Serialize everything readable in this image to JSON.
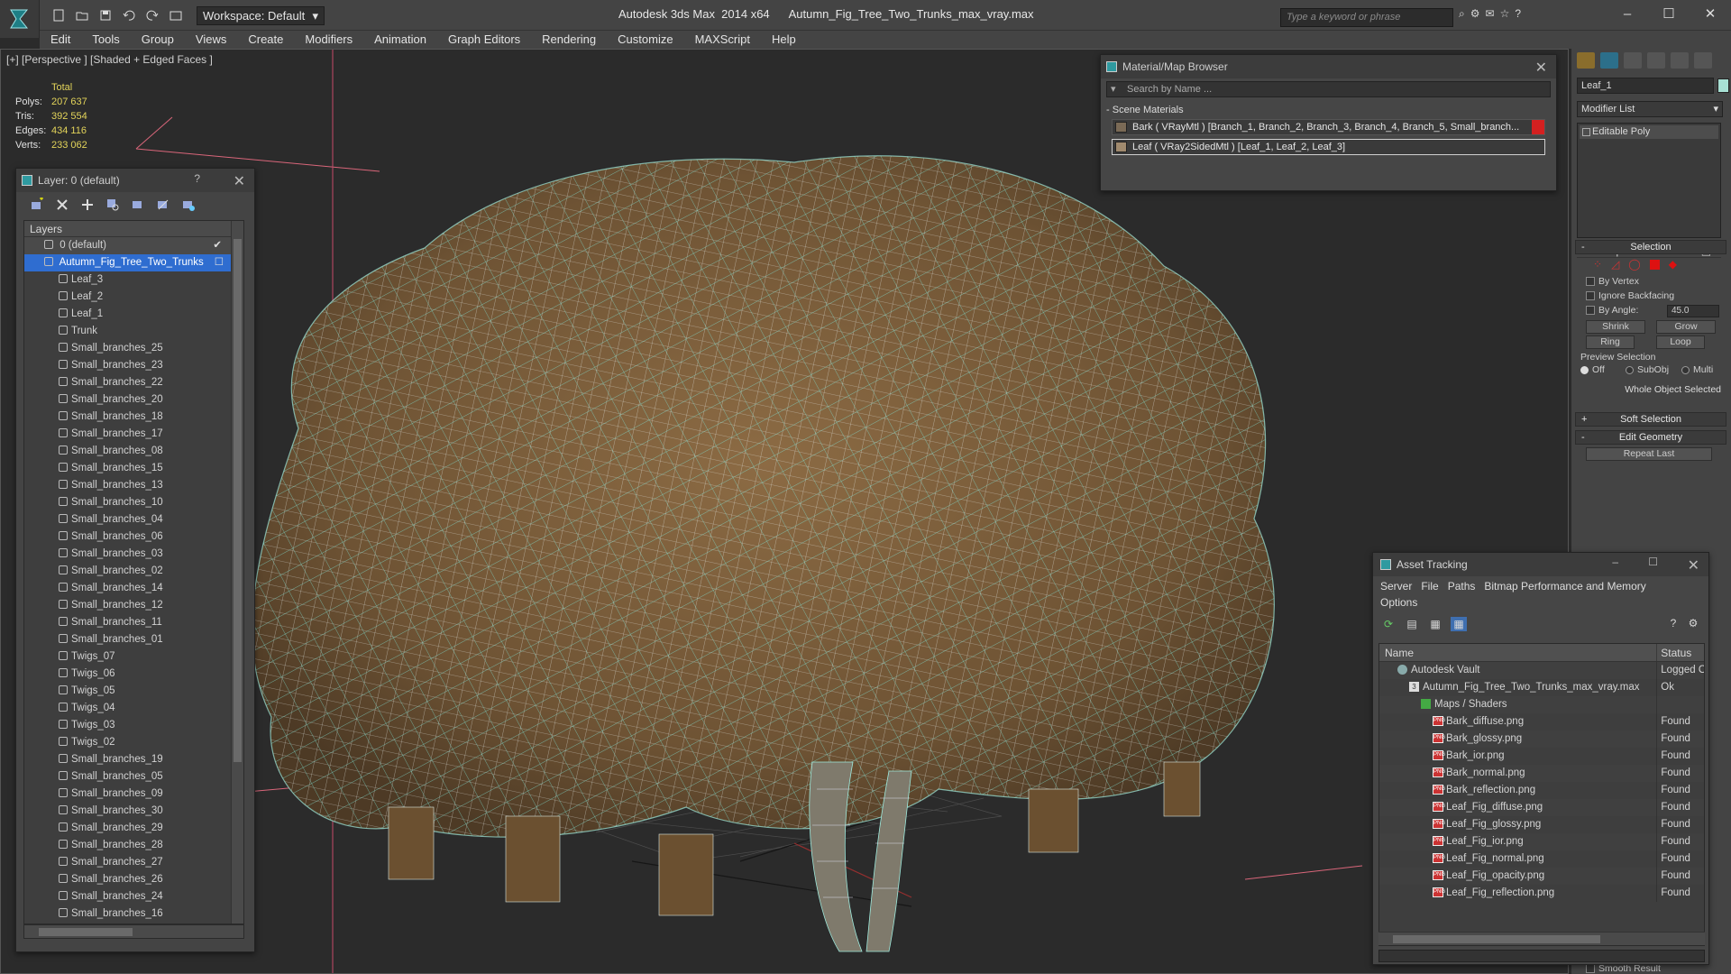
{
  "title_bar": {
    "workspace": "Workspace: Default",
    "window_title": "Autodesk 3ds Max  2014 x64      Autumn_Fig_Tree_Two_Trunks_max_vray.max",
    "search_placeholder": "Type a keyword or phrase"
  },
  "menu": [
    "Edit",
    "Tools",
    "Group",
    "Views",
    "Create",
    "Modifiers",
    "Animation",
    "Graph Editors",
    "Rendering",
    "Customize",
    "MAXScript",
    "Help"
  ],
  "viewport": {
    "label": "[+] [Perspective ] [Shaded + Edged Faces ]",
    "stats_header": "Total",
    "stats": [
      {
        "k": "Polys:",
        "v": "207 637"
      },
      {
        "k": "Tris:",
        "v": "392 554"
      },
      {
        "k": "Edges:",
        "v": "434 116"
      },
      {
        "k": "Verts:",
        "v": "233 062"
      }
    ]
  },
  "layer_panel": {
    "title": "Layer: 0 (default)",
    "help": "?",
    "list_header": "Layers",
    "default_layer": "0 (default)",
    "active_layer": "Autumn_Fig_Tree_Two_Trunks",
    "objects": [
      "Leaf_3",
      "Leaf_2",
      "Leaf_1",
      "Trunk",
      "Small_branches_25",
      "Small_branches_23",
      "Small_branches_22",
      "Small_branches_20",
      "Small_branches_18",
      "Small_branches_17",
      "Small_branches_08",
      "Small_branches_15",
      "Small_branches_13",
      "Small_branches_10",
      "Small_branches_04",
      "Small_branches_06",
      "Small_branches_03",
      "Small_branches_02",
      "Small_branches_14",
      "Small_branches_12",
      "Small_branches_11",
      "Small_branches_01",
      "Twigs_07",
      "Twigs_06",
      "Twigs_05",
      "Twigs_04",
      "Twigs_03",
      "Twigs_02",
      "Small_branches_19",
      "Small_branches_05",
      "Small_branches_09",
      "Small_branches_30",
      "Small_branches_29",
      "Small_branches_28",
      "Small_branches_27",
      "Small_branches_26",
      "Small_branches_24",
      "Small_branches_16"
    ]
  },
  "material_browser": {
    "title": "Material/Map Browser",
    "search_placeholder": "Search by Name ...",
    "section": "Scene Materials",
    "materials": [
      "Bark  ( VRayMtl )  [Branch_1, Branch_2, Branch_3, Branch_4, Branch_5, Small_branch...",
      "Leaf  ( VRay2SidedMtl )  [Leaf_1, Leaf_2, Leaf_3]"
    ]
  },
  "command_panel": {
    "object_name": "Leaf_1",
    "modifier_list": "Modifier List",
    "stack_item": "Editable Poly",
    "selection": {
      "title": "Selection",
      "by_vertex": "By Vertex",
      "ignore_backfacing": "Ignore Backfacing",
      "by_angle": "By Angle:",
      "angle_value": "45.0",
      "shrink": "Shrink",
      "grow": "Grow",
      "ring": "Ring",
      "loop": "Loop",
      "preview_selection": "Preview Selection",
      "off": "Off",
      "subobj": "SubObj",
      "multi": "Multi",
      "status": "Whole Object Selected"
    },
    "soft_selection": "Soft Selection",
    "edit_geometry": "Edit Geometry",
    "repeat_last": "Repeat Last",
    "smooth_result": "Smooth Result"
  },
  "asset_tracking": {
    "title": "Asset Tracking",
    "menu": [
      "Server",
      "File",
      "Paths",
      "Bitmap Performance and Memory"
    ],
    "options": "Options",
    "col_name": "Name",
    "col_status": "Status",
    "rows": [
      {
        "name": "Autodesk Vault",
        "status": "Logged O",
        "level": 0,
        "icon": "vault"
      },
      {
        "name": "Autumn_Fig_Tree_Two_Trunks_max_vray.max",
        "status": "Ok",
        "level": 1,
        "icon": "max"
      },
      {
        "name": "Maps / Shaders",
        "status": "",
        "level": 2,
        "icon": "maps"
      },
      {
        "name": "Bark_diffuse.png",
        "status": "Found",
        "level": 3,
        "icon": "png"
      },
      {
        "name": "Bark_glossy.png",
        "status": "Found",
        "level": 3,
        "icon": "png"
      },
      {
        "name": "Bark_ior.png",
        "status": "Found",
        "level": 3,
        "icon": "png"
      },
      {
        "name": "Bark_normal.png",
        "status": "Found",
        "level": 3,
        "icon": "png"
      },
      {
        "name": "Bark_reflection.png",
        "status": "Found",
        "level": 3,
        "icon": "png"
      },
      {
        "name": "Leaf_Fig_diffuse.png",
        "status": "Found",
        "level": 3,
        "icon": "png"
      },
      {
        "name": "Leaf_Fig_glossy.png",
        "status": "Found",
        "level": 3,
        "icon": "png"
      },
      {
        "name": "Leaf_Fig_ior.png",
        "status": "Found",
        "level": 3,
        "icon": "png"
      },
      {
        "name": "Leaf_Fig_normal.png",
        "status": "Found",
        "level": 3,
        "icon": "png"
      },
      {
        "name": "Leaf_Fig_opacity.png",
        "status": "Found",
        "level": 3,
        "icon": "png"
      },
      {
        "name": "Leaf_Fig_reflection.png",
        "status": "Found",
        "level": 3,
        "icon": "png"
      }
    ]
  },
  "colors": {
    "stats_value": "#e3d45a",
    "selection_blue": "#2f6dd0",
    "wire_cyan": "#7fe6d8",
    "leaf_brown": "#8a6a42",
    "object_swatch": "#a8e0d4"
  }
}
